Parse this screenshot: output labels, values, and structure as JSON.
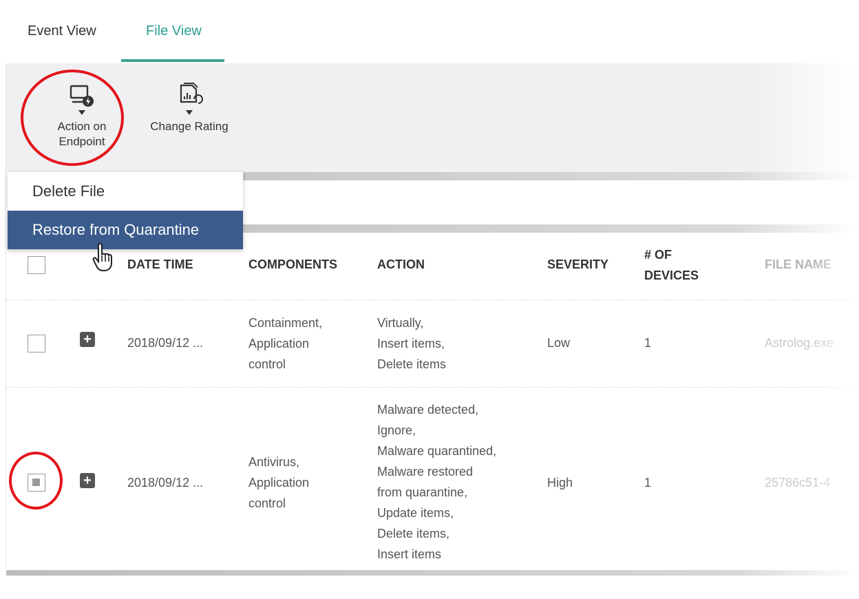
{
  "tabs": [
    {
      "label": "Event View",
      "active": false
    },
    {
      "label": "File View",
      "active": true
    }
  ],
  "toolbar": {
    "action_on_endpoint": {
      "line1": "Action on",
      "line2": "Endpoint",
      "icon": "monitor-lightning-icon"
    },
    "change_rating": {
      "label": "Change Rating",
      "icon": "document-rating-icon"
    }
  },
  "menu": {
    "items": [
      {
        "label": "Delete File",
        "selected": false
      },
      {
        "label": "Restore from Quarantine",
        "selected": true
      }
    ]
  },
  "table": {
    "headers": {
      "date_time": "DATE TIME",
      "components": "COMPONENTS",
      "action": "ACTION",
      "severity": "SEVERITY",
      "devices_line1": "# OF",
      "devices_line2": "DEVICES",
      "file_name": "FILE NAME"
    },
    "rows": [
      {
        "checked": false,
        "date_time": "2018/09/12 ...",
        "components": [
          "Containment,",
          "Application",
          "control"
        ],
        "action": [
          "Virtually,",
          "Insert items,",
          "Delete items"
        ],
        "severity": "Low",
        "devices": "1",
        "file_name": "Astrolog.exe"
      },
      {
        "checked": "indeterminate",
        "date_time": "2018/09/12 ...",
        "components": [
          "Antivirus,",
          "Application",
          "control"
        ],
        "action": [
          "Malware detected,",
          "Ignore,",
          "Malware quarantined,",
          "Malware restored",
          "from quarantine,",
          "Update items,",
          "Delete items,",
          "Insert items"
        ],
        "severity": "High",
        "devices": "1",
        "file_name": "25786c51-4"
      }
    ]
  },
  "colors": {
    "accent": "#3aa68f",
    "menu_selected": "#3a5b8c",
    "highlight_circle": "#e3141b"
  }
}
